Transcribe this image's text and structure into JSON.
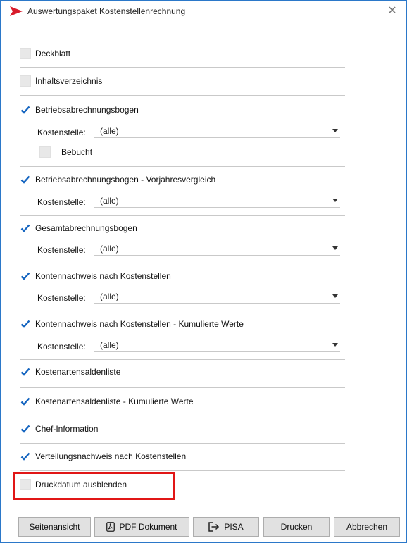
{
  "window": {
    "title": "Auswertungspaket Kostenstellenrechnung",
    "close_icon": "close-icon"
  },
  "options": [
    {
      "id": "deckblatt",
      "label": "Deckblatt",
      "checked": false
    },
    {
      "id": "inhaltsverzeichnis",
      "label": "Inhaltsverzeichnis",
      "checked": false
    },
    {
      "id": "betriebsabrechnungsbogen",
      "label": "Betriebsabrechnungsbogen",
      "checked": true,
      "kostenstelle_label": "Kostenstelle:",
      "kostenstelle_value": "(alle)",
      "sub_label": "Bebucht",
      "sub_checked": false
    },
    {
      "id": "bab-vorjahr",
      "label": "Betriebsabrechnungsbogen - Vorjahresvergleich",
      "checked": true,
      "kostenstelle_label": "Kostenstelle:",
      "kostenstelle_value": "(alle)"
    },
    {
      "id": "gesamtabrechnungsbogen",
      "label": "Gesamtabrechnungsbogen",
      "checked": true,
      "kostenstelle_label": "Kostenstelle:",
      "kostenstelle_value": "(alle)"
    },
    {
      "id": "kontennachweis",
      "label": "Kontennachweis nach Kostenstellen",
      "checked": true,
      "kostenstelle_label": "Kostenstelle:",
      "kostenstelle_value": "(alle)"
    },
    {
      "id": "kontennachweis-kum",
      "label": "Kontennachweis nach Kostenstellen - Kumulierte Werte",
      "checked": true,
      "kostenstelle_label": "Kostenstelle:",
      "kostenstelle_value": "(alle)"
    },
    {
      "id": "kostenartensaldenliste",
      "label": "Kostenartensaldenliste",
      "checked": true
    },
    {
      "id": "kostenartensaldenliste-kum",
      "label": "Kostenartensaldenliste - Kumulierte Werte",
      "checked": true
    },
    {
      "id": "chef-information",
      "label": "Chef-Information",
      "checked": true
    },
    {
      "id": "verteilungsnachweis",
      "label": "Verteilungsnachweis nach Kostenstellen",
      "checked": true
    },
    {
      "id": "druckdatum",
      "label": "Druckdatum ausblenden",
      "checked": false
    }
  ],
  "buttons": {
    "seitenansicht": "Seitenansicht",
    "pdf": "PDF Dokument",
    "pisa": "PISA",
    "drucken": "Drucken",
    "abbrechen": "Abbrechen"
  },
  "colors": {
    "accent": "#1565c0",
    "highlight": "#e11616",
    "logo": "#d81b2a"
  }
}
